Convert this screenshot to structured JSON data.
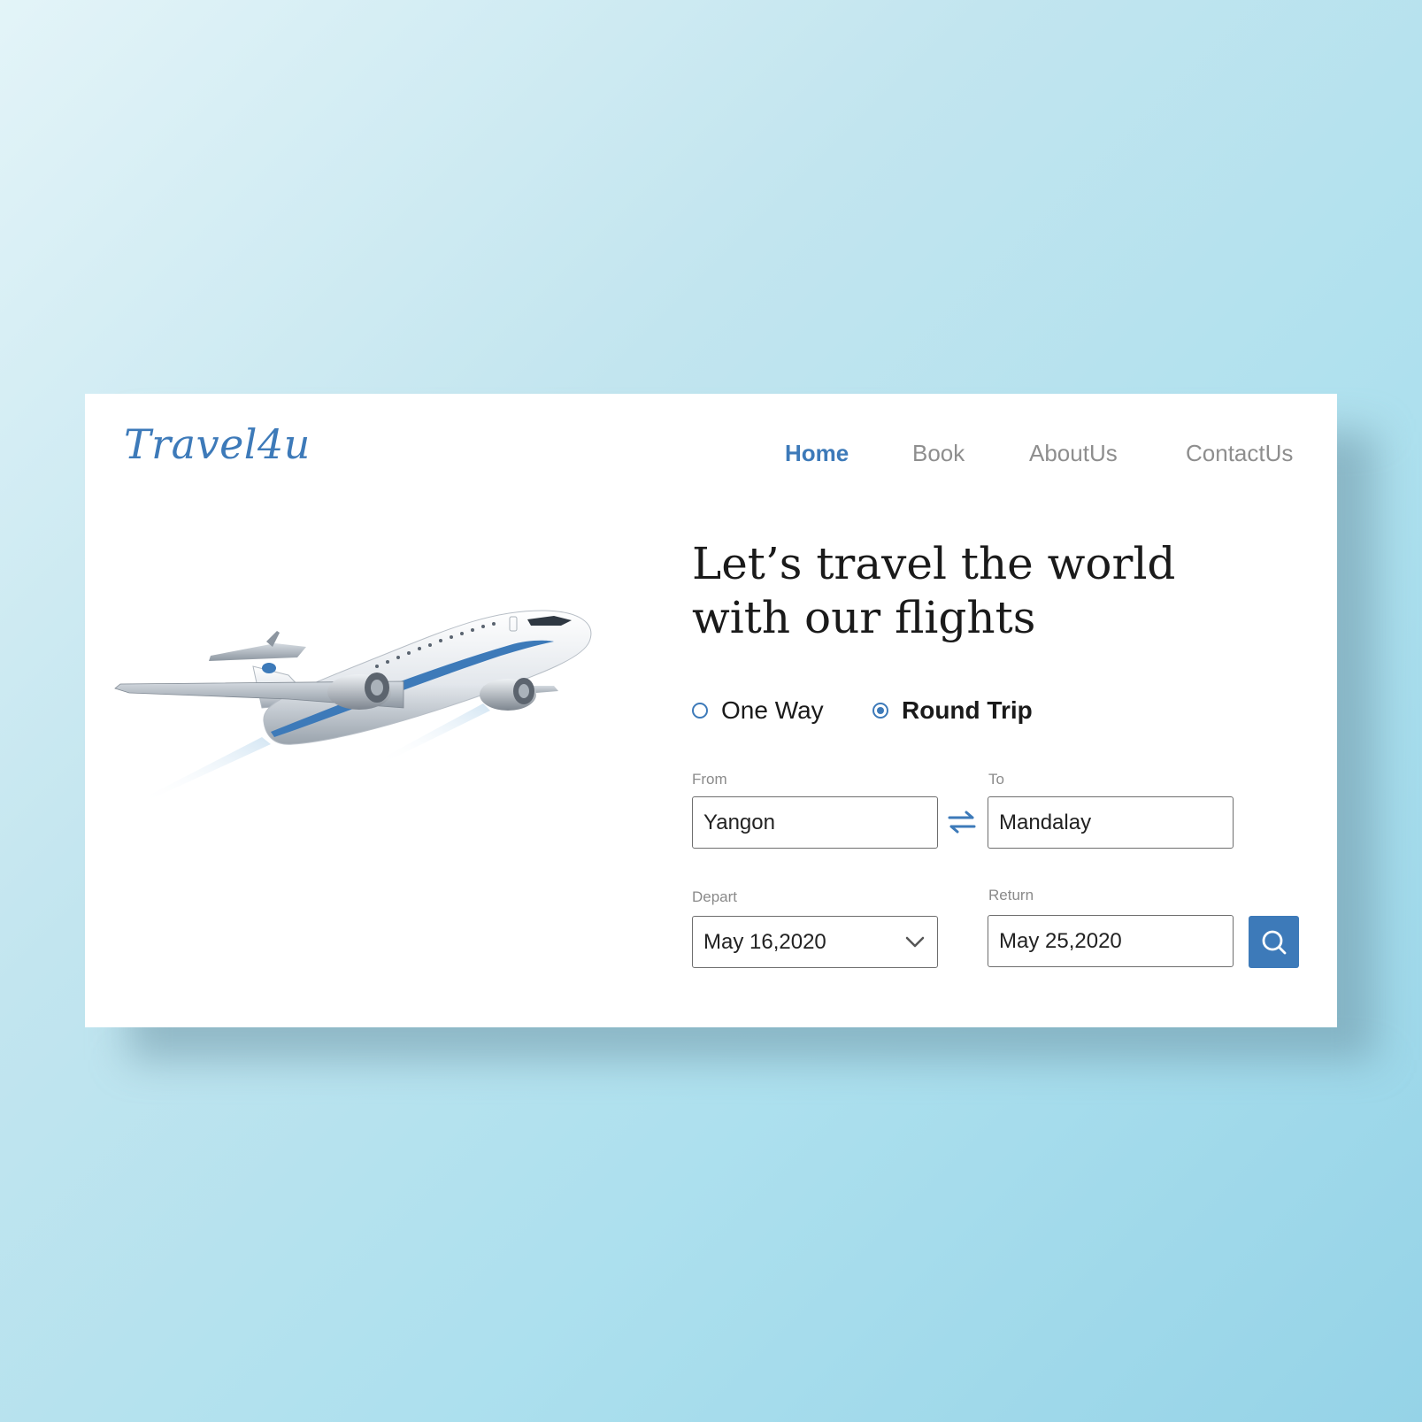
{
  "brand": {
    "name": "Travel4u"
  },
  "nav": {
    "items": [
      {
        "label": "Home",
        "active": true
      },
      {
        "label": "Book",
        "active": false
      },
      {
        "label": "AboutUs",
        "active": false
      },
      {
        "label": "ContactUs",
        "active": false
      }
    ]
  },
  "hero": {
    "headline_line1": "Let’s travel the world",
    "headline_line2": "with our flights",
    "image_icon": "airplane-illustration"
  },
  "trip_type": {
    "options": [
      {
        "label": "One Way",
        "selected": false
      },
      {
        "label": "Round Trip",
        "selected": true
      }
    ]
  },
  "form": {
    "from_label": "From",
    "from_value": "Yangon",
    "to_label": "To",
    "to_value": "Mandalay",
    "swap_icon": "swap-arrows-icon",
    "depart_label": "Depart",
    "depart_value": "May 16,2020",
    "return_label": "Return",
    "return_value": "May 25,2020",
    "search_icon": "search-icon"
  },
  "colors": {
    "accent": "#3d7ab9",
    "nav_inactive": "#8e8e8e",
    "text": "#1a1a1a",
    "card": "#ffffff"
  }
}
